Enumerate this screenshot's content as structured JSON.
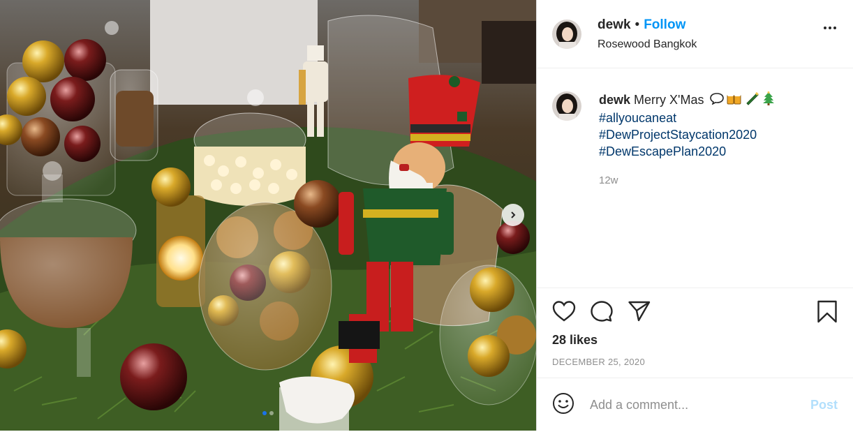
{
  "post": {
    "username": "dewk",
    "separator": "•",
    "follow_label": "Follow",
    "location": "Rosewood Bangkok",
    "photo_alt": "Christmas table with nutcracker and ornaments"
  },
  "caption": {
    "username": "dewk",
    "text": "Merry X'Mas",
    "emojis": [
      "speech-bubble-icon",
      "beer-mugs-icon",
      "champagne-icon",
      "christmas-tree-icon"
    ],
    "hashtags": [
      "#allyoucaneat",
      "#DewProjectStaycation2020",
      "#DewEscapePlan2020"
    ],
    "age": "12w"
  },
  "engagement": {
    "likes": "28 likes",
    "date": "DECEMBER 25, 2020"
  },
  "comment": {
    "placeholder": "Add a comment...",
    "post_label": "Post"
  },
  "carousel": {
    "total": 2,
    "current": 1
  },
  "colors": {
    "follow": "#0095f6",
    "hashtag": "#00376b",
    "muted": "#8e8e8e",
    "post_disabled": "#b2dffc"
  }
}
